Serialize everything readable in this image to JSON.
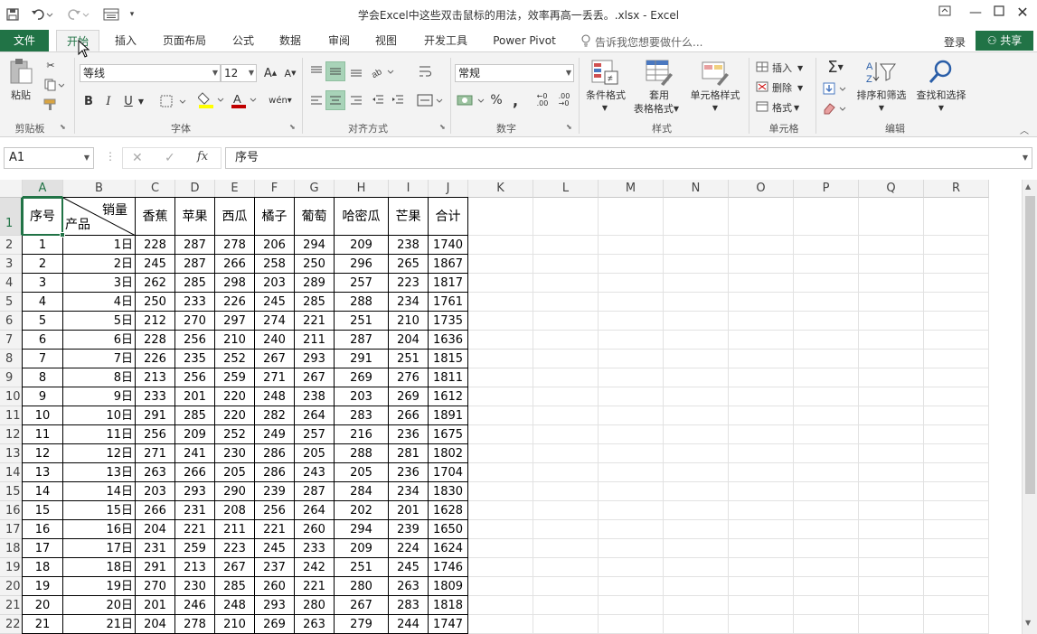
{
  "window": {
    "title": "学会Excel中这些双击鼠标的用法，效率再高一丢丢。.xlsx - Excel"
  },
  "tabs": {
    "file": "文件",
    "items": [
      "开始",
      "插入",
      "页面布局",
      "公式",
      "数据",
      "审阅",
      "视图",
      "开发工具",
      "Power Pivot"
    ],
    "active_index": 0,
    "tell_me": "告诉我您想要做什么...",
    "login": "登录",
    "share": "共享"
  },
  "ribbon": {
    "clipboard": {
      "paste": "粘贴",
      "label": "剪贴板"
    },
    "font": {
      "name": "等线",
      "size": "12",
      "bold": "B",
      "italic": "I",
      "underline": "U",
      "label": "字体"
    },
    "alignment": {
      "label": "对齐方式"
    },
    "number": {
      "format": "常规",
      "percent": "%",
      "comma": ",",
      "label": "数字"
    },
    "styles": {
      "conditional": "条件格式",
      "table_1": "套用",
      "table_2": "表格格式",
      "cell_styles": "单元格样式",
      "label": "样式"
    },
    "cells": {
      "insert": "插入",
      "delete": "删除",
      "format": "格式",
      "label": "单元格"
    },
    "editing": {
      "sort": "排序和筛选",
      "find": "查找和选择",
      "label": "编辑"
    }
  },
  "formula_bar": {
    "name_box": "A1",
    "fx": "fx",
    "content": "序号"
  },
  "sheet": {
    "columns": [
      "A",
      "B",
      "C",
      "D",
      "E",
      "F",
      "G",
      "H",
      "I",
      "J",
      "K",
      "L",
      "M",
      "N",
      "O",
      "P",
      "Q",
      "R"
    ],
    "row_numbers": [
      "1",
      "2",
      "3",
      "4",
      "5",
      "6",
      "7",
      "8",
      "9",
      "10",
      "11",
      "12",
      "13",
      "14",
      "15",
      "16",
      "17",
      "18",
      "19",
      "20",
      "21",
      "22"
    ],
    "header": {
      "a": "序号",
      "b_top": "销量",
      "b_bottom": "产品",
      "fruits": [
        "香蕉",
        "苹果",
        "西瓜",
        "橘子",
        "葡萄",
        "哈密瓜",
        "芒果",
        "合计"
      ]
    },
    "rows": [
      [
        "1",
        "1日",
        "228",
        "287",
        "278",
        "206",
        "294",
        "209",
        "238",
        "1740"
      ],
      [
        "2",
        "2日",
        "245",
        "287",
        "266",
        "258",
        "250",
        "296",
        "265",
        "1867"
      ],
      [
        "3",
        "3日",
        "262",
        "285",
        "298",
        "203",
        "289",
        "257",
        "223",
        "1817"
      ],
      [
        "4",
        "4日",
        "250",
        "233",
        "226",
        "245",
        "285",
        "288",
        "234",
        "1761"
      ],
      [
        "5",
        "5日",
        "212",
        "270",
        "297",
        "274",
        "221",
        "251",
        "210",
        "1735"
      ],
      [
        "6",
        "6日",
        "228",
        "256",
        "210",
        "240",
        "211",
        "287",
        "204",
        "1636"
      ],
      [
        "7",
        "7日",
        "226",
        "235",
        "252",
        "267",
        "293",
        "291",
        "251",
        "1815"
      ],
      [
        "8",
        "8日",
        "213",
        "256",
        "259",
        "271",
        "267",
        "269",
        "276",
        "1811"
      ],
      [
        "9",
        "9日",
        "233",
        "201",
        "220",
        "248",
        "238",
        "203",
        "269",
        "1612"
      ],
      [
        "10",
        "10日",
        "291",
        "285",
        "220",
        "282",
        "264",
        "283",
        "266",
        "1891"
      ],
      [
        "11",
        "11日",
        "256",
        "209",
        "252",
        "249",
        "257",
        "216",
        "236",
        "1675"
      ],
      [
        "12",
        "12日",
        "271",
        "241",
        "230",
        "286",
        "205",
        "288",
        "281",
        "1802"
      ],
      [
        "13",
        "13日",
        "263",
        "266",
        "205",
        "286",
        "243",
        "205",
        "236",
        "1704"
      ],
      [
        "14",
        "14日",
        "203",
        "293",
        "290",
        "239",
        "287",
        "284",
        "234",
        "1830"
      ],
      [
        "15",
        "15日",
        "266",
        "231",
        "208",
        "256",
        "264",
        "202",
        "201",
        "1628"
      ],
      [
        "16",
        "16日",
        "204",
        "221",
        "211",
        "221",
        "260",
        "294",
        "239",
        "1650"
      ],
      [
        "17",
        "17日",
        "231",
        "259",
        "223",
        "245",
        "233",
        "209",
        "224",
        "1624"
      ],
      [
        "18",
        "18日",
        "291",
        "213",
        "267",
        "237",
        "242",
        "251",
        "245",
        "1746"
      ],
      [
        "19",
        "19日",
        "270",
        "230",
        "285",
        "260",
        "221",
        "280",
        "263",
        "1809"
      ],
      [
        "20",
        "20日",
        "201",
        "246",
        "248",
        "293",
        "280",
        "267",
        "283",
        "1818"
      ],
      [
        "21",
        "21日",
        "204",
        "278",
        "210",
        "269",
        "263",
        "279",
        "244",
        "1747"
      ]
    ]
  },
  "colors": {
    "excel_green": "#217346"
  }
}
